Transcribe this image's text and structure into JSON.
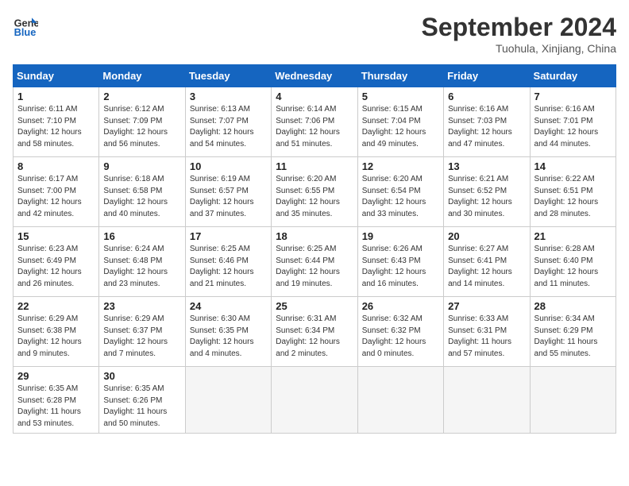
{
  "header": {
    "logo_line1": "General",
    "logo_line2": "Blue",
    "month": "September 2024",
    "location": "Tuohula, Xinjiang, China"
  },
  "weekdays": [
    "Sunday",
    "Monday",
    "Tuesday",
    "Wednesday",
    "Thursday",
    "Friday",
    "Saturday"
  ],
  "weeks": [
    [
      {
        "day": "1",
        "text": "Sunrise: 6:11 AM\nSunset: 7:10 PM\nDaylight: 12 hours\nand 58 minutes."
      },
      {
        "day": "2",
        "text": "Sunrise: 6:12 AM\nSunset: 7:09 PM\nDaylight: 12 hours\nand 56 minutes."
      },
      {
        "day": "3",
        "text": "Sunrise: 6:13 AM\nSunset: 7:07 PM\nDaylight: 12 hours\nand 54 minutes."
      },
      {
        "day": "4",
        "text": "Sunrise: 6:14 AM\nSunset: 7:06 PM\nDaylight: 12 hours\nand 51 minutes."
      },
      {
        "day": "5",
        "text": "Sunrise: 6:15 AM\nSunset: 7:04 PM\nDaylight: 12 hours\nand 49 minutes."
      },
      {
        "day": "6",
        "text": "Sunrise: 6:16 AM\nSunset: 7:03 PM\nDaylight: 12 hours\nand 47 minutes."
      },
      {
        "day": "7",
        "text": "Sunrise: 6:16 AM\nSunset: 7:01 PM\nDaylight: 12 hours\nand 44 minutes."
      }
    ],
    [
      {
        "day": "8",
        "text": "Sunrise: 6:17 AM\nSunset: 7:00 PM\nDaylight: 12 hours\nand 42 minutes."
      },
      {
        "day": "9",
        "text": "Sunrise: 6:18 AM\nSunset: 6:58 PM\nDaylight: 12 hours\nand 40 minutes."
      },
      {
        "day": "10",
        "text": "Sunrise: 6:19 AM\nSunset: 6:57 PM\nDaylight: 12 hours\nand 37 minutes."
      },
      {
        "day": "11",
        "text": "Sunrise: 6:20 AM\nSunset: 6:55 PM\nDaylight: 12 hours\nand 35 minutes."
      },
      {
        "day": "12",
        "text": "Sunrise: 6:20 AM\nSunset: 6:54 PM\nDaylight: 12 hours\nand 33 minutes."
      },
      {
        "day": "13",
        "text": "Sunrise: 6:21 AM\nSunset: 6:52 PM\nDaylight: 12 hours\nand 30 minutes."
      },
      {
        "day": "14",
        "text": "Sunrise: 6:22 AM\nSunset: 6:51 PM\nDaylight: 12 hours\nand 28 minutes."
      }
    ],
    [
      {
        "day": "15",
        "text": "Sunrise: 6:23 AM\nSunset: 6:49 PM\nDaylight: 12 hours\nand 26 minutes."
      },
      {
        "day": "16",
        "text": "Sunrise: 6:24 AM\nSunset: 6:48 PM\nDaylight: 12 hours\nand 23 minutes."
      },
      {
        "day": "17",
        "text": "Sunrise: 6:25 AM\nSunset: 6:46 PM\nDaylight: 12 hours\nand 21 minutes."
      },
      {
        "day": "18",
        "text": "Sunrise: 6:25 AM\nSunset: 6:44 PM\nDaylight: 12 hours\nand 19 minutes."
      },
      {
        "day": "19",
        "text": "Sunrise: 6:26 AM\nSunset: 6:43 PM\nDaylight: 12 hours\nand 16 minutes."
      },
      {
        "day": "20",
        "text": "Sunrise: 6:27 AM\nSunset: 6:41 PM\nDaylight: 12 hours\nand 14 minutes."
      },
      {
        "day": "21",
        "text": "Sunrise: 6:28 AM\nSunset: 6:40 PM\nDaylight: 12 hours\nand 11 minutes."
      }
    ],
    [
      {
        "day": "22",
        "text": "Sunrise: 6:29 AM\nSunset: 6:38 PM\nDaylight: 12 hours\nand 9 minutes."
      },
      {
        "day": "23",
        "text": "Sunrise: 6:29 AM\nSunset: 6:37 PM\nDaylight: 12 hours\nand 7 minutes."
      },
      {
        "day": "24",
        "text": "Sunrise: 6:30 AM\nSunset: 6:35 PM\nDaylight: 12 hours\nand 4 minutes."
      },
      {
        "day": "25",
        "text": "Sunrise: 6:31 AM\nSunset: 6:34 PM\nDaylight: 12 hours\nand 2 minutes."
      },
      {
        "day": "26",
        "text": "Sunrise: 6:32 AM\nSunset: 6:32 PM\nDaylight: 12 hours\nand 0 minutes."
      },
      {
        "day": "27",
        "text": "Sunrise: 6:33 AM\nSunset: 6:31 PM\nDaylight: 11 hours\nand 57 minutes."
      },
      {
        "day": "28",
        "text": "Sunrise: 6:34 AM\nSunset: 6:29 PM\nDaylight: 11 hours\nand 55 minutes."
      }
    ],
    [
      {
        "day": "29",
        "text": "Sunrise: 6:35 AM\nSunset: 6:28 PM\nDaylight: 11 hours\nand 53 minutes."
      },
      {
        "day": "30",
        "text": "Sunrise: 6:35 AM\nSunset: 6:26 PM\nDaylight: 11 hours\nand 50 minutes."
      },
      {
        "day": "",
        "text": ""
      },
      {
        "day": "",
        "text": ""
      },
      {
        "day": "",
        "text": ""
      },
      {
        "day": "",
        "text": ""
      },
      {
        "day": "",
        "text": ""
      }
    ]
  ]
}
